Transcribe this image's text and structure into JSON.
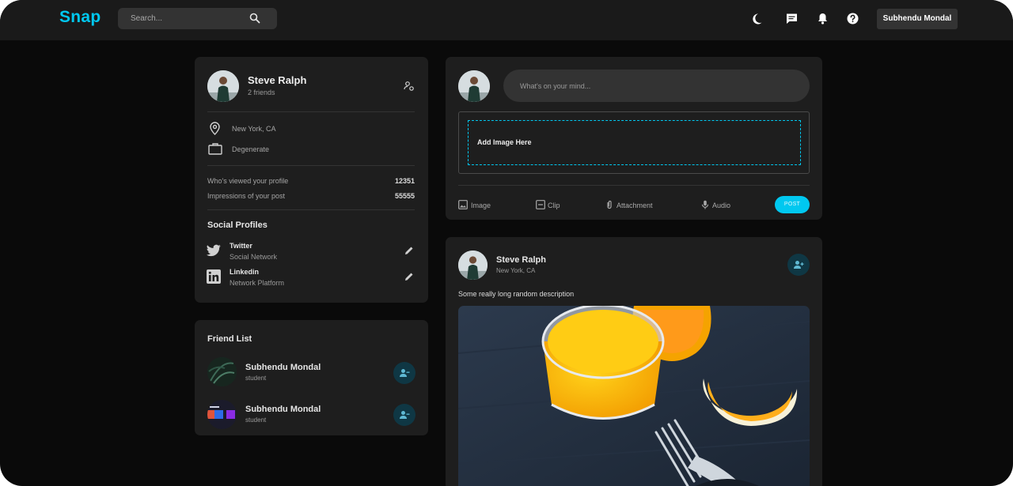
{
  "header": {
    "logo": "Snap",
    "search_placeholder": "Search...",
    "icons": [
      "search-icon",
      "dark-mode-moon-icon",
      "messages-icon",
      "notifications-bell-icon",
      "help-icon"
    ],
    "user_name": "Subhendu Mondal"
  },
  "profile": {
    "name": "Steve Ralph",
    "friends": "2 friends",
    "location": "New York, CA",
    "occupation": "Degenerate",
    "stats": [
      {
        "label": "Who's viewed your profile",
        "value": "12351"
      },
      {
        "label": "Impressions of your post",
        "value": "55555"
      }
    ],
    "social_title": "Social Profiles",
    "socials": [
      {
        "name": "Twitter",
        "type": "Social Network",
        "icon": "twitter-icon"
      },
      {
        "name": "Linkedin",
        "type": "Network Platform",
        "icon": "linkedin-icon"
      }
    ]
  },
  "friends": {
    "title": "Friend List",
    "items": [
      {
        "name": "Subhendu Mondal",
        "role": "student"
      },
      {
        "name": "Subhendu Mondal",
        "role": "student"
      }
    ]
  },
  "composer": {
    "placeholder": "What's on your mind...",
    "dropzone_label": "Add Image Here",
    "tools": [
      "Image",
      "Clip",
      "Attachment",
      "Audio"
    ],
    "post_label": "POST"
  },
  "post": {
    "author": "Steve Ralph",
    "location": "New York, CA",
    "description": "Some really long random description"
  },
  "colors": {
    "accent": "#00c8f0",
    "background": "#0a0a0a",
    "card": "#1e1e1e",
    "topbar": "#1a1a1a"
  }
}
